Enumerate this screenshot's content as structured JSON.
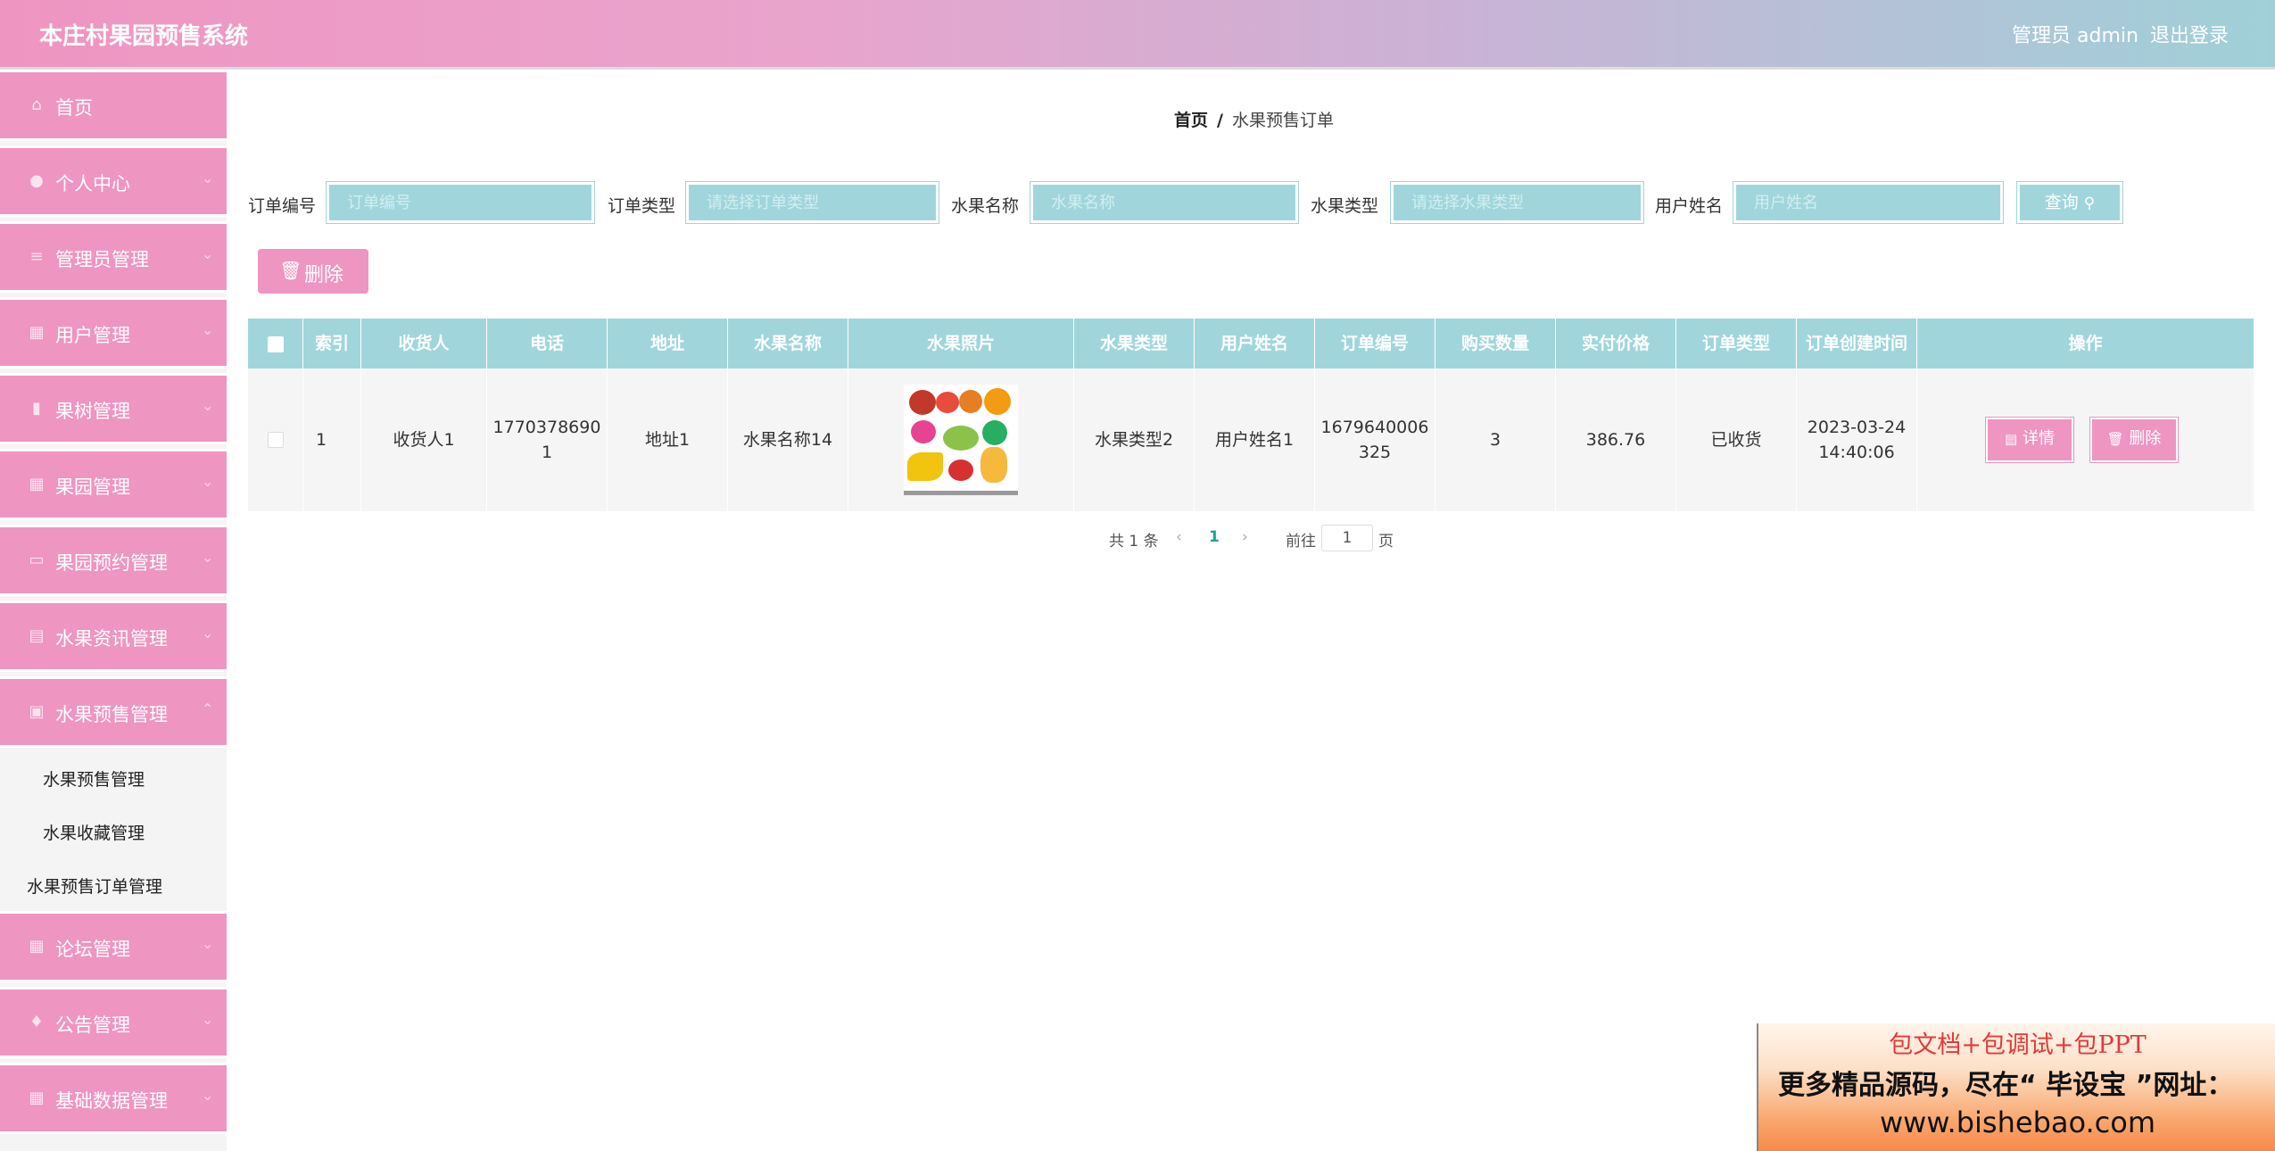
{
  "header": {
    "title": "本庄村果园预售系统",
    "admin_label": "管理员 admin",
    "logout_label": "退出登录"
  },
  "sidebar": {
    "items": [
      {
        "label": "首页",
        "icon": "home-icon"
      },
      {
        "label": "个人中心",
        "icon": "user-icon"
      },
      {
        "label": "管理员管理",
        "icon": "list-icon"
      },
      {
        "label": "用户管理",
        "icon": "users-icon"
      },
      {
        "label": "果树管理",
        "icon": "chart-icon"
      },
      {
        "label": "果园管理",
        "icon": "grid-icon"
      },
      {
        "label": "果园预约管理",
        "icon": "calendar-icon"
      },
      {
        "label": "水果资讯管理",
        "icon": "news-icon"
      },
      {
        "label": "水果预售管理",
        "icon": "bag-icon"
      },
      {
        "label": "论坛管理",
        "icon": "grid-icon"
      },
      {
        "label": "公告管理",
        "icon": "bell-icon"
      },
      {
        "label": "基础数据管理",
        "icon": "grid-icon"
      }
    ],
    "sub_items": [
      {
        "label": "水果预售管理"
      },
      {
        "label": "水果收藏管理"
      },
      {
        "label": "水果预售订单管理"
      }
    ]
  },
  "breadcrumb": {
    "home": "首页",
    "separator": "/",
    "current": "水果预售订单"
  },
  "filters": {
    "order_no_label": "订单编号",
    "order_no_placeholder": "订单编号",
    "order_type_label": "订单类型",
    "order_type_placeholder": "请选择订单类型",
    "fruit_name_label": "水果名称",
    "fruit_name_placeholder": "水果名称",
    "fruit_type_label": "水果类型",
    "fruit_type_placeholder": "请选择水果类型",
    "user_name_label": "用户姓名",
    "user_name_placeholder": "用户姓名",
    "search_label": "查询"
  },
  "toolbar": {
    "delete_label": "删除"
  },
  "table": {
    "columns": [
      "索引",
      "收货人",
      "电话",
      "地址",
      "水果名称",
      "水果照片",
      "水果类型",
      "用户姓名",
      "订单编号",
      "购买数量",
      "实付价格",
      "订单类型",
      "订单创建时间",
      "操作"
    ],
    "rows": [
      {
        "index": "1",
        "receiver": "收货人1",
        "phone_line1": "1770378690",
        "phone_line2": "1",
        "address": "地址1",
        "fruit_name": "水果名称14",
        "fruit_type": "水果类型2",
        "user_name": "用户姓名1",
        "order_no_line1": "1679640006",
        "order_no_line2": "325",
        "quantity": "3",
        "price": "386.76",
        "order_type": "已收货",
        "created_date": "2023-03-24",
        "created_time": "14:40:06",
        "detail_label": "详情",
        "delete_label": "删除"
      }
    ]
  },
  "pagination": {
    "total": "共 1 条",
    "current_page": "1",
    "goto_label": "前往",
    "goto_value": "1",
    "page_suffix": "页"
  },
  "watermark": {
    "line1": "包文档+包调试+包PPT",
    "line2": "更多精品源码，尽在“ 毕设宝 ”网址：",
    "line3": "www.bishebao.com"
  },
  "colors": {
    "accent_pink": "#ef95c2",
    "accent_teal": "#a0d6db"
  }
}
